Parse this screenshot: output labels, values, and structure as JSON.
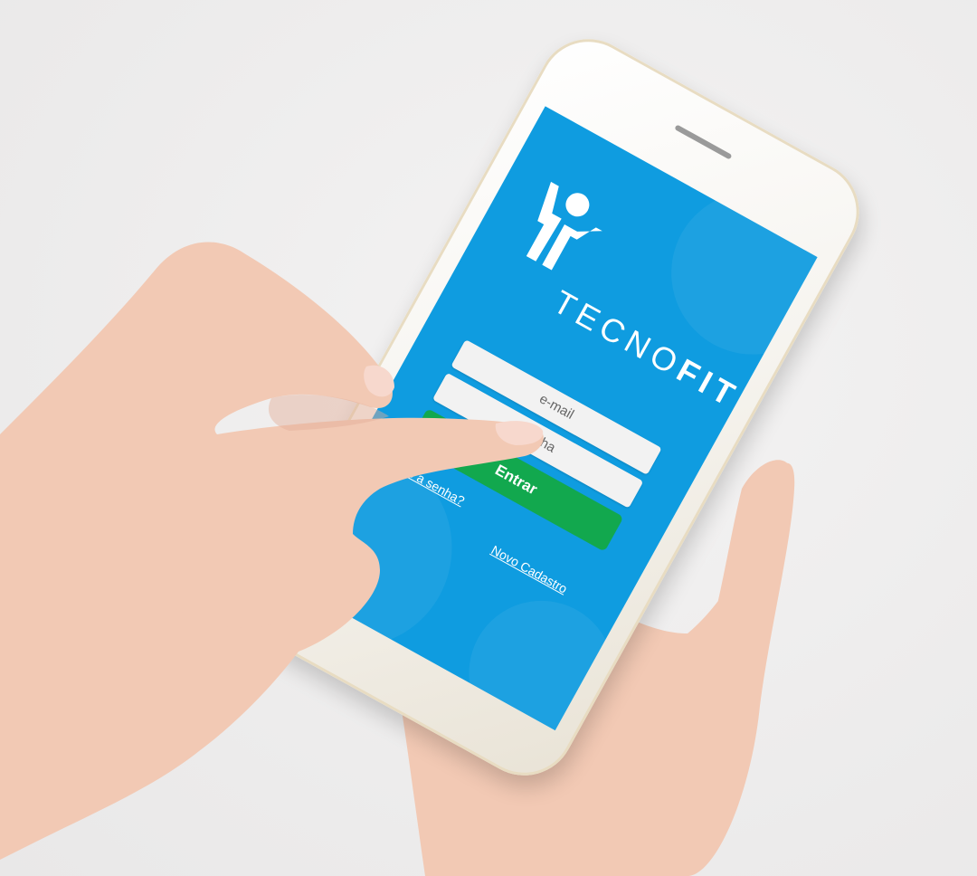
{
  "app": {
    "logo_text_light": "TECNO",
    "logo_text_bold": "FIT"
  },
  "login": {
    "email_placeholder": "e-mail",
    "password_placeholder": "senha",
    "submit_label": "Entrar",
    "forgot_password_link": "Esqueceu a senha?",
    "forgot_password_visible": "...o a senha?",
    "register_link": "Novo Cadastro"
  },
  "colors": {
    "screen_bg": "#0f9ce0",
    "button_green": "#12a84e",
    "input_bg": "#f2f2f2",
    "phone_body": "#f6f4ef",
    "background": "#efeeee",
    "skin": "#f2c9b4"
  },
  "icons": [
    "tecnofit-logo-icon"
  ]
}
